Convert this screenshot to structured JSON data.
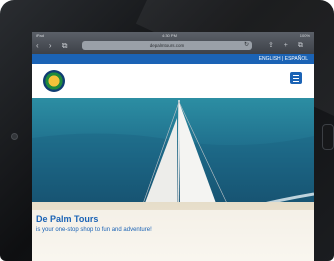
{
  "browser": {
    "carrier": "iPad",
    "time": "4:30 PM",
    "battery": "100%",
    "nav_icons": "‹ › ⧉",
    "url": "depalmtours.com",
    "right_icons": "⇪ + ⧉"
  },
  "site": {
    "language_links": "ENGLISH | ESPAÑOL",
    "hero_title": "De Palm Tours",
    "hero_subtitle": "is your one-stop shop to fun and adventure!"
  }
}
